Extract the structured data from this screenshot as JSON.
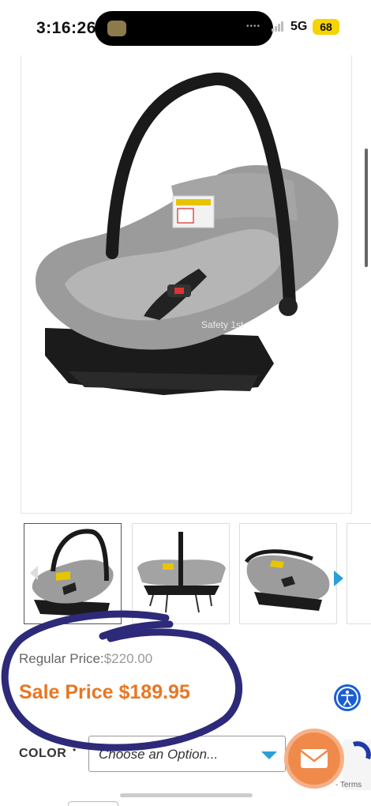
{
  "status_bar": {
    "time": "3:16:26",
    "network": "5G",
    "battery": "68",
    "signal_dots": "••••"
  },
  "product": {
    "main_image_icon": "infant-car-seat",
    "thumbnails": [
      "infant-car-seat-front",
      "infant-car-seat-side",
      "infant-car-seat-angle"
    ],
    "regular_price_label": "Regular Price:",
    "regular_price_value": "$220.00",
    "sale_price": "Sale Price $189.95",
    "color_label": "COLOR",
    "required_marker": "•",
    "color_select_placeholder": "Choose an Option...",
    "brand_mark": "Safety 1st"
  },
  "widgets": {
    "recaptcha_terms": "- Terms",
    "accessibility_icon": "accessibility-icon",
    "chat_icon": "mail-icon"
  },
  "colors": {
    "sale_orange": "#e87722",
    "accent_blue": "#2a9fd8",
    "mail_orange": "#f08a4b",
    "pen_mark": "#2d2a7a"
  }
}
